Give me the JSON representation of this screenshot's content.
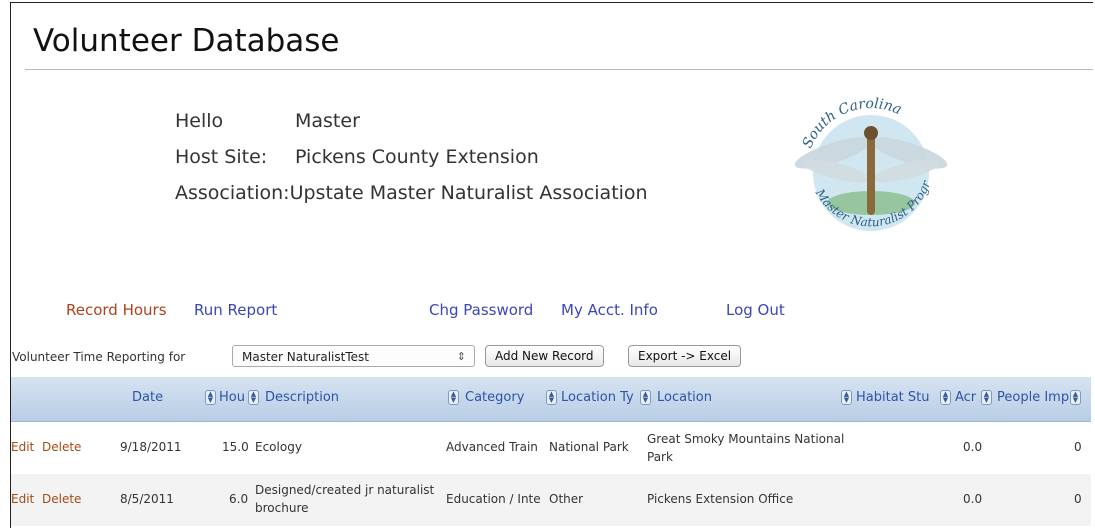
{
  "app": {
    "title": "Volunteer Database"
  },
  "info": {
    "hello_label": "Hello",
    "hello_value": "Master",
    "host_label": "Host Site:",
    "host_value": "Pickens County Extension",
    "assoc_label": "Association:",
    "assoc_value": "Upstate Master Naturalist Association"
  },
  "logo": {
    "top_text": "South Carolina",
    "bottom_text": "Master Naturalist Program"
  },
  "nav": {
    "record_hours": "Record Hours",
    "run_report": "Run Report",
    "chg_password": "Chg Password",
    "my_acct": "My Acct. Info",
    "log_out": "Log Out"
  },
  "toolbar": {
    "label": "Volunteer Time Reporting for",
    "selected": "Master NaturalistTest",
    "add_new": "Add New Record",
    "export": "Export -> Excel"
  },
  "columns": {
    "date": "Date",
    "hours": "Hou",
    "description": "Description",
    "category": "Category",
    "location_type": "Location Ty",
    "location": "Location",
    "habitat": "Habitat Stu",
    "acres": "Acr",
    "people": "People Imp"
  },
  "rows": [
    {
      "edit": "Edit",
      "delete": "Delete",
      "date": "9/18/2011",
      "hours": "15.0",
      "description": "Ecology",
      "category": "Advanced Train",
      "location_type": "National Park",
      "location": "Great Smoky Mountains National Park",
      "acres": "0.0",
      "people": "0"
    },
    {
      "edit": "Edit",
      "delete": "Delete",
      "date": "8/5/2011",
      "hours": "6.0",
      "description": "Designed/created jr naturalist brochure",
      "category": "Education / Inte",
      "location_type": "Other",
      "location": "Pickens Extension Office",
      "acres": "0.0",
      "people": "0"
    }
  ],
  "colors": {
    "link": "#3b46b8",
    "active_link": "#b0401c",
    "header": "#2d54a8"
  }
}
